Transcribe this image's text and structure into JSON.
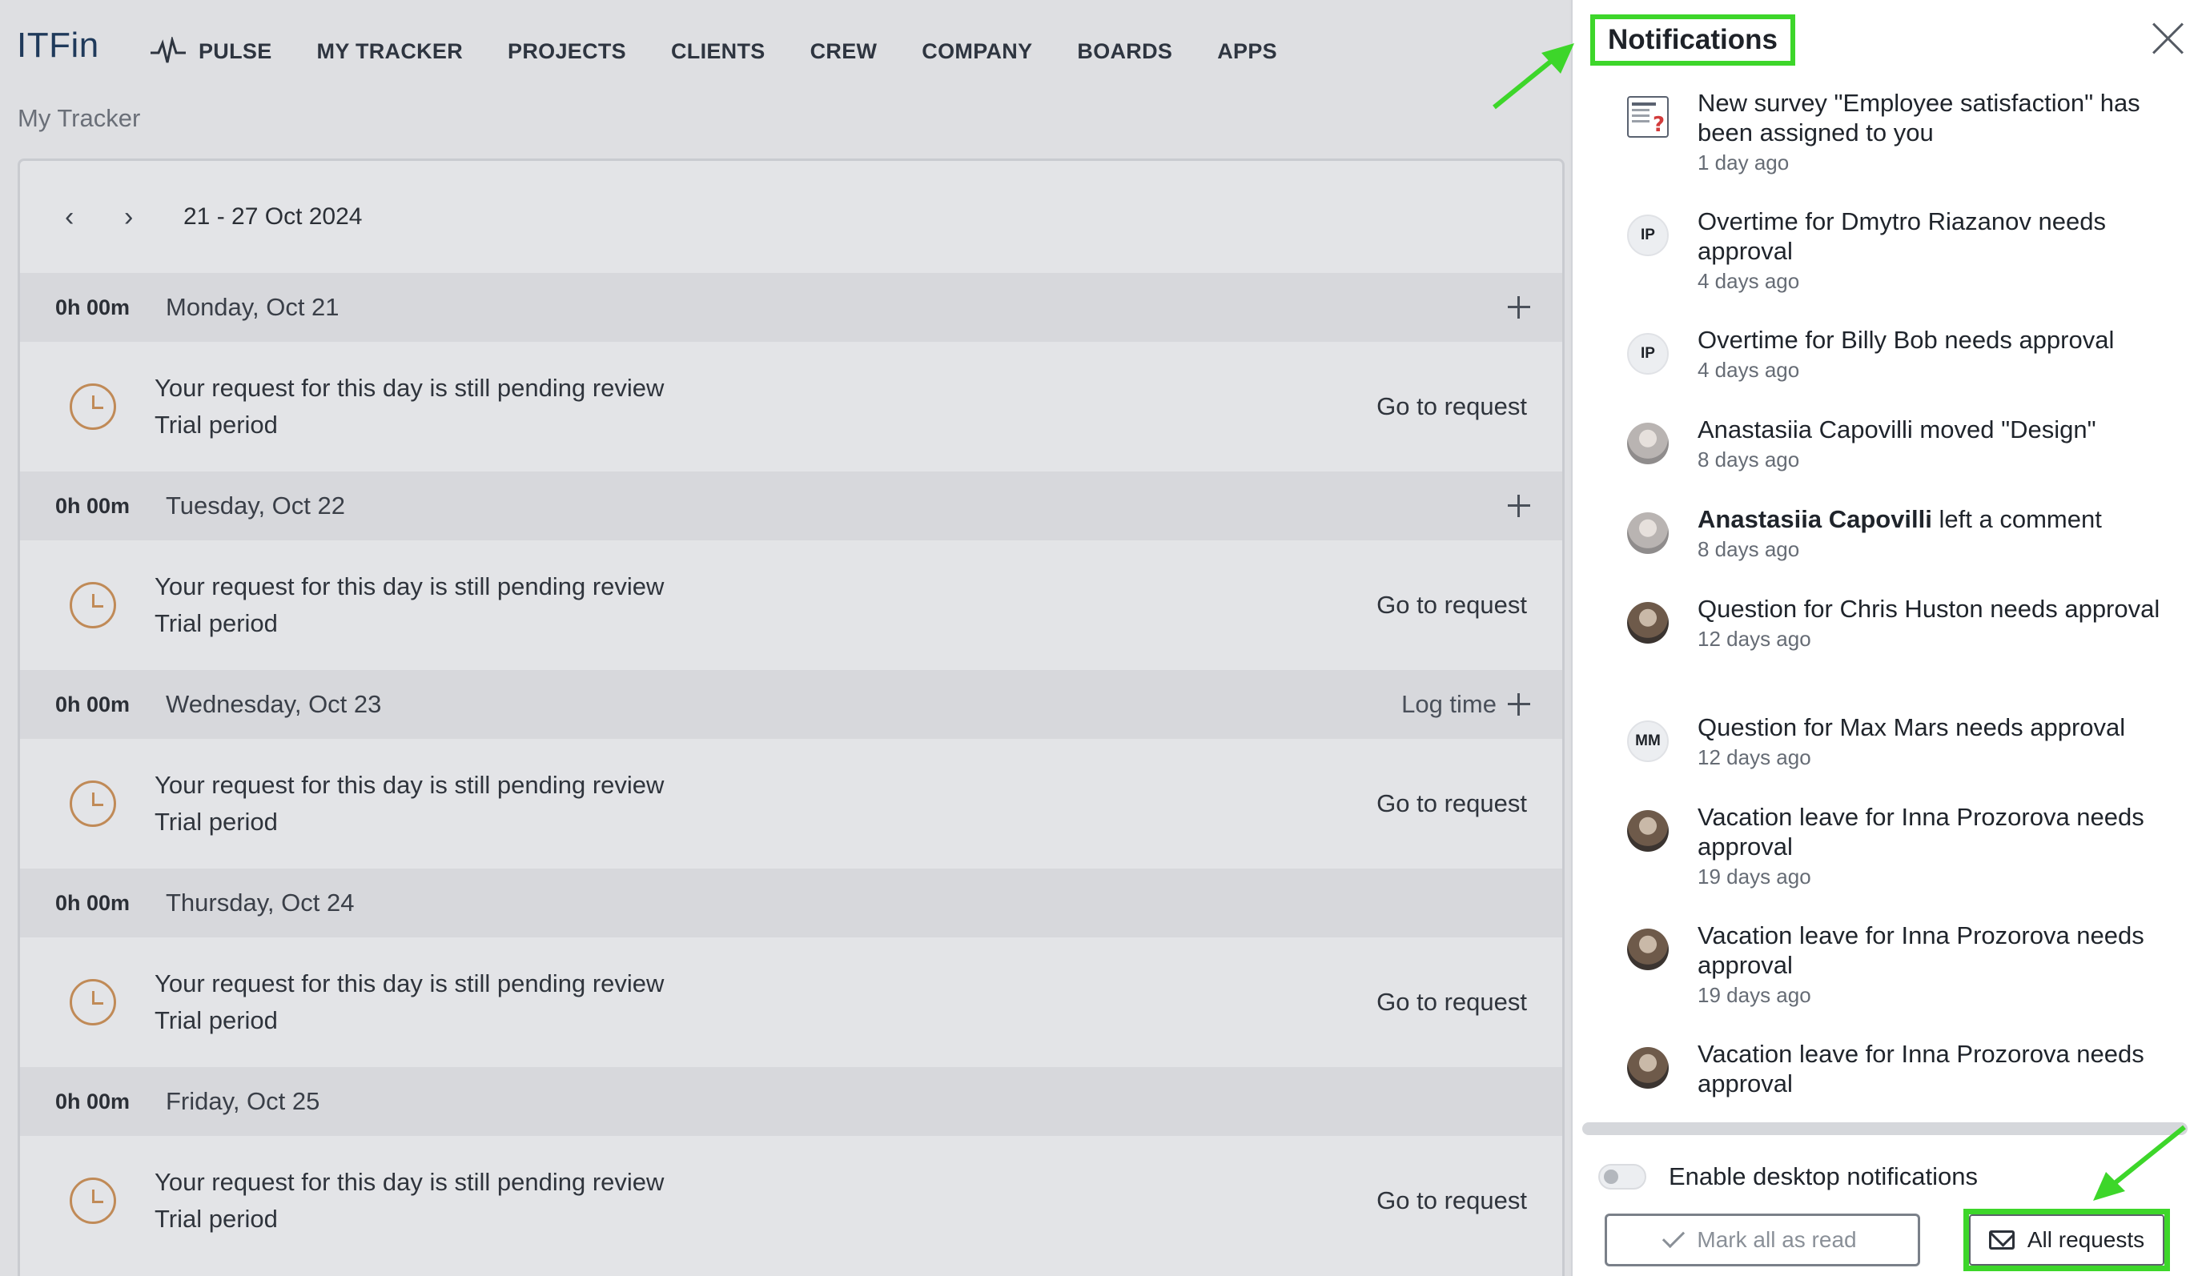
{
  "app": {
    "logo": "ITFin",
    "nav": [
      "PULSE",
      "MY TRACKER",
      "PROJECTS",
      "CLIENTS",
      "CREW",
      "COMPANY",
      "BOARDS",
      "APPS"
    ],
    "breadcrumb": "My Tracker"
  },
  "tracker": {
    "prev_icon": "chevron-left-icon",
    "next_icon": "chevron-right-icon",
    "week_range": "21 - 27 Oct 2024",
    "days": [
      {
        "total": "0h 00m",
        "name": "Monday, Oct 21",
        "action": "",
        "add": true,
        "pending": "Your request for this day is still pending review",
        "reason": "Trial period",
        "link": "Go to request"
      },
      {
        "total": "0h 00m",
        "name": "Tuesday, Oct 22",
        "action": "",
        "add": true,
        "pending": "Your request for this day is still pending review",
        "reason": "Trial period",
        "link": "Go to request"
      },
      {
        "total": "0h 00m",
        "name": "Wednesday, Oct 23",
        "action": "Log time",
        "add": true,
        "pending": "Your request for this day is still pending review",
        "reason": "Trial period",
        "link": "Go to request"
      },
      {
        "total": "0h 00m",
        "name": "Thursday, Oct 24",
        "action": "",
        "add": false,
        "pending": "Your request for this day is still pending review",
        "reason": "Trial period",
        "link": "Go to request"
      },
      {
        "total": "0h 00m",
        "name": "Friday, Oct 25",
        "action": "",
        "add": false,
        "pending": "Your request for this day is still pending review",
        "reason": "Trial period",
        "link": "Go to request"
      }
    ]
  },
  "notifications": {
    "title": "Notifications",
    "items": [
      {
        "avatar": "survey",
        "initials": "",
        "bold": "",
        "title": "New survey \"Employee satisfaction\" has been assigned to you",
        "time": "1 day ago"
      },
      {
        "avatar": "initials",
        "initials": "IP",
        "bold": "",
        "title": "Overtime for Dmytro Riazanov needs approval",
        "time": "4 days ago"
      },
      {
        "avatar": "initials",
        "initials": "IP",
        "bold": "",
        "title": "Overtime for Billy Bob needs approval",
        "time": "4 days ago"
      },
      {
        "avatar": "photo-light",
        "initials": "",
        "bold": "",
        "title": "Anastasiia Capovilli moved \"Design\"",
        "time": "8 days ago"
      },
      {
        "avatar": "photo-light",
        "initials": "",
        "bold": "Anastasiia Capovilli",
        "title": " left a comment",
        "time": "8 days ago"
      },
      {
        "avatar": "photo",
        "initials": "",
        "bold": "",
        "title": "Question for Chris Huston needs approval",
        "time": "12 days ago"
      },
      {
        "avatar": "initials",
        "initials": "MM",
        "bold": "",
        "title": "Question for Max Mars needs approval",
        "time": "12 days ago"
      },
      {
        "avatar": "photo",
        "initials": "",
        "bold": "",
        "title": "Vacation leave for Inna Prozorova needs approval",
        "time": "19 days ago"
      },
      {
        "avatar": "photo",
        "initials": "",
        "bold": "",
        "title": "Vacation leave for Inna Prozorova needs approval",
        "time": "19 days ago"
      },
      {
        "avatar": "photo",
        "initials": "",
        "bold": "",
        "title": "Vacation leave for Inna Prozorova needs approval",
        "time": ""
      }
    ],
    "desktop_toggle_label": "Enable desktop notifications",
    "desktop_toggle_on": false,
    "mark_all_label": "Mark all as read",
    "all_requests_label": "All requests"
  },
  "colors": {
    "annotation_green": "#3dd62a",
    "clock_accent": "#c08a57"
  }
}
